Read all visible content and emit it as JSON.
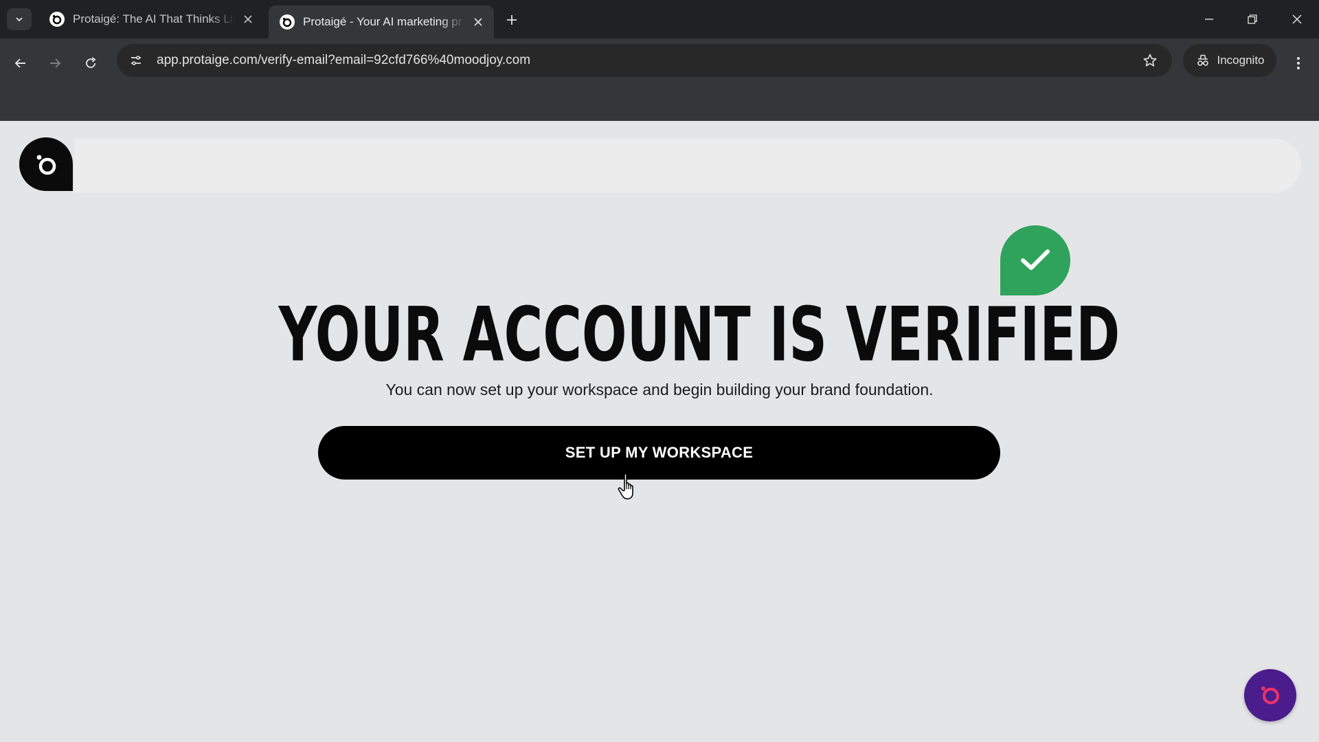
{
  "browser": {
    "tabs": [
      {
        "title": "Protaigé: The AI That Thinks Lik",
        "active": false
      },
      {
        "title": "Protaigé - Your AI marketing pr",
        "active": true
      }
    ],
    "url": "app.protaige.com/verify-email?email=92cfd766%40moodjoy.com",
    "incognito_label": "Incognito"
  },
  "page": {
    "headline": "YOUR ACCOUNT IS VERIFIED",
    "subtext": "You can now set up your workspace and begin building your brand foundation.",
    "cta_label": "SET UP MY WORKSPACE"
  },
  "colors": {
    "success_badge": "#2fa35c",
    "cta_background": "#000000",
    "chat_button": "#4a1c8c",
    "chat_icon": "#e8336b",
    "page_background": "#e4e5e7"
  },
  "icons": {
    "logo": "protaige-logo-icon",
    "badge": "checkmark-icon",
    "chat": "chat-widget-icon"
  }
}
